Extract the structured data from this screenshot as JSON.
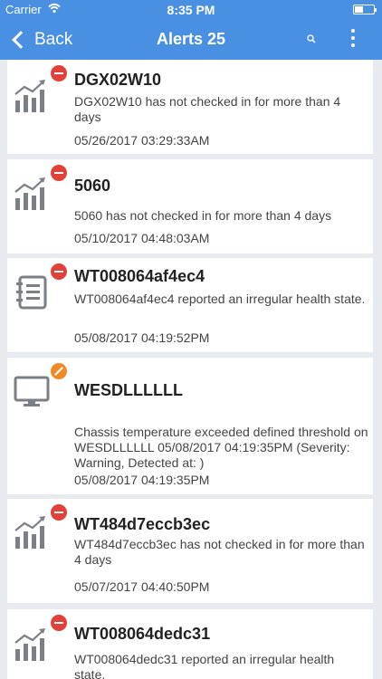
{
  "status_bar": {
    "carrier": "Carrier",
    "time": "8:35 PM"
  },
  "nav": {
    "back_label": "Back",
    "title": "Alerts 25"
  },
  "colors": {
    "accent": "#4a90e2",
    "critical_badge": "#e2413b",
    "warning_badge": "#f08a24",
    "icon_gray": "#7b7f86"
  },
  "alerts": [
    {
      "icon": "chart-trend-icon",
      "severity": "critical",
      "title": "DGX02W10",
      "message": "DGX02W10 has not checked in for more than 4 days",
      "timestamp": "05/26/2017 03:29:33AM"
    },
    {
      "icon": "chart-trend-icon",
      "severity": "critical",
      "title": "5060",
      "message": "5060 has not checked in for more than 4 days",
      "timestamp": "05/10/2017 04:48:03AM"
    },
    {
      "icon": "notebook-icon",
      "severity": "critical",
      "title": "WT008064af4ec4",
      "message": "WT008064af4ec4 reported an irregular health state.",
      "timestamp": "05/08/2017 04:19:52PM"
    },
    {
      "icon": "monitor-icon",
      "severity": "warning",
      "title": "WESDLLLLLL",
      "message": "Chassis temperature exceeded defined threshold on WESDLLLLLL 05/08/2017 04:19:35PM (Severity: Warning, Detected at: )",
      "timestamp": "05/08/2017 04:19:35PM"
    },
    {
      "icon": "chart-trend-icon",
      "severity": "critical",
      "title": "WT484d7eccb3ec",
      "message": "WT484d7eccb3ec has not checked in for more than 4 days",
      "timestamp": "05/07/2017 04:40:50PM"
    },
    {
      "icon": "chart-trend-icon",
      "severity": "critical",
      "title": "WT008064dedc31",
      "message": "WT008064dedc31 reported an irregular health state.",
      "timestamp": ""
    }
  ]
}
